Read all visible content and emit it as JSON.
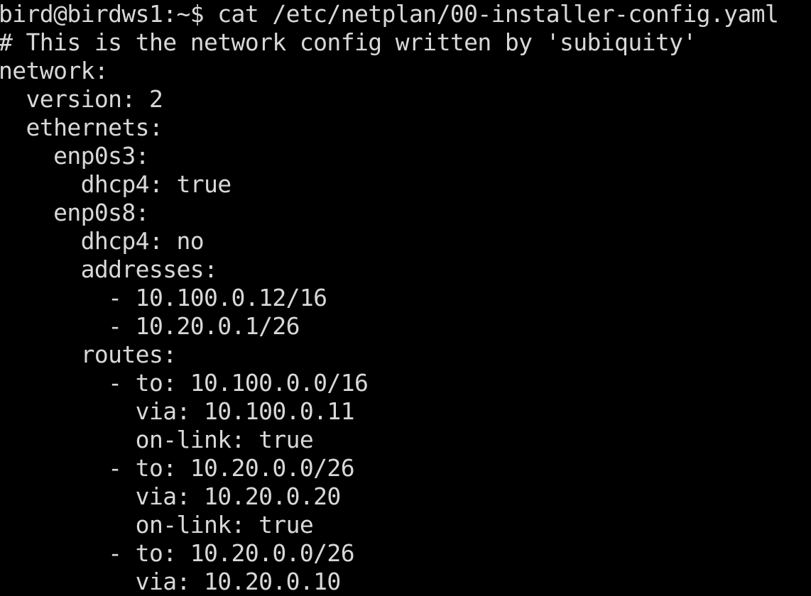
{
  "terminal": {
    "lines": [
      "bird@birdws1:~$ cat /etc/netplan/00-installer-config.yaml",
      "# This is the network config written by 'subiquity'",
      "network:",
      "  version: 2",
      "  ethernets:",
      "    enp0s3:",
      "      dhcp4: true",
      "    enp0s8:",
      "      dhcp4: no",
      "      addresses:",
      "        - 10.100.0.12/16",
      "        - 10.20.0.1/26",
      "      routes:",
      "        - to: 10.100.0.0/16",
      "          via: 10.100.0.11",
      "          on-link: true",
      "        - to: 10.20.0.0/26",
      "          via: 10.20.0.20",
      "          on-link: true",
      "        - to: 10.20.0.0/26",
      "          via: 10.20.0.10"
    ]
  },
  "colors": {
    "background": "#000000",
    "foreground": "#d8d8d8"
  }
}
